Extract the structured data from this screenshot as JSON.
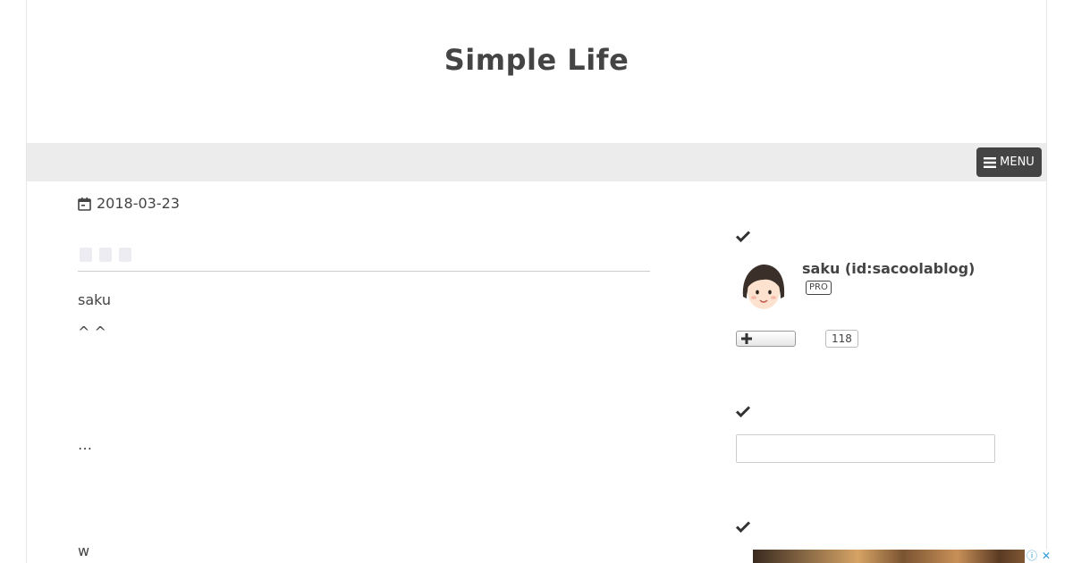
{
  "header": {
    "site_title": "Simple Life"
  },
  "nav": {
    "menu_label": "MENU"
  },
  "article": {
    "date": "2018-03-23",
    "lines": [
      "saku",
      "^ ^",
      "…",
      "w"
    ]
  },
  "sidebar": {
    "profile": {
      "name": "saku (id:sacoolablog)",
      "badge": "PRO",
      "follower_count": "118"
    },
    "search": {
      "placeholder": "",
      "value": ""
    }
  },
  "ad": {
    "info_glyph": "ⓘ",
    "close_glyph": "✕"
  },
  "icons": {
    "menu": "hamburger-icon",
    "date": "calendar-icon",
    "section": "check-icon",
    "follow": "plus-icon"
  },
  "colors": {
    "text": "#444444",
    "nav_bar": "#ececec",
    "menu_button": "#444444",
    "ad_icon": "#2b9bd6"
  }
}
